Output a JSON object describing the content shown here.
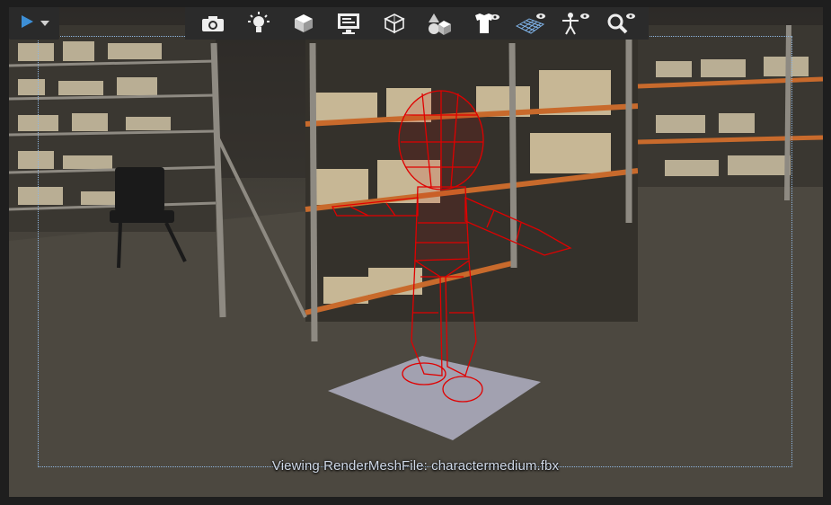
{
  "toolbar": {
    "play_menu": {
      "icon": "play-icon",
      "dropdown_icon": "chevron-down-icon"
    },
    "tools": [
      {
        "icon": "camera-icon"
      },
      {
        "icon": "light-bulb-icon"
      },
      {
        "icon": "cube-solid-icon"
      },
      {
        "icon": "monitor-icon"
      },
      {
        "icon": "wireframe-cube-icon"
      },
      {
        "icon": "shapes-icon"
      },
      {
        "icon": "shirt-visibility-icon"
      },
      {
        "icon": "grid-visibility-icon"
      },
      {
        "icon": "skeleton-visibility-icon"
      },
      {
        "icon": "zoom-visibility-icon"
      }
    ]
  },
  "viewport": {
    "status_text": "Viewing RenderMeshFile: charactermedium.fbx",
    "wireframe_color": "#e00000",
    "safe_frame_color": "#8fb6e0"
  }
}
